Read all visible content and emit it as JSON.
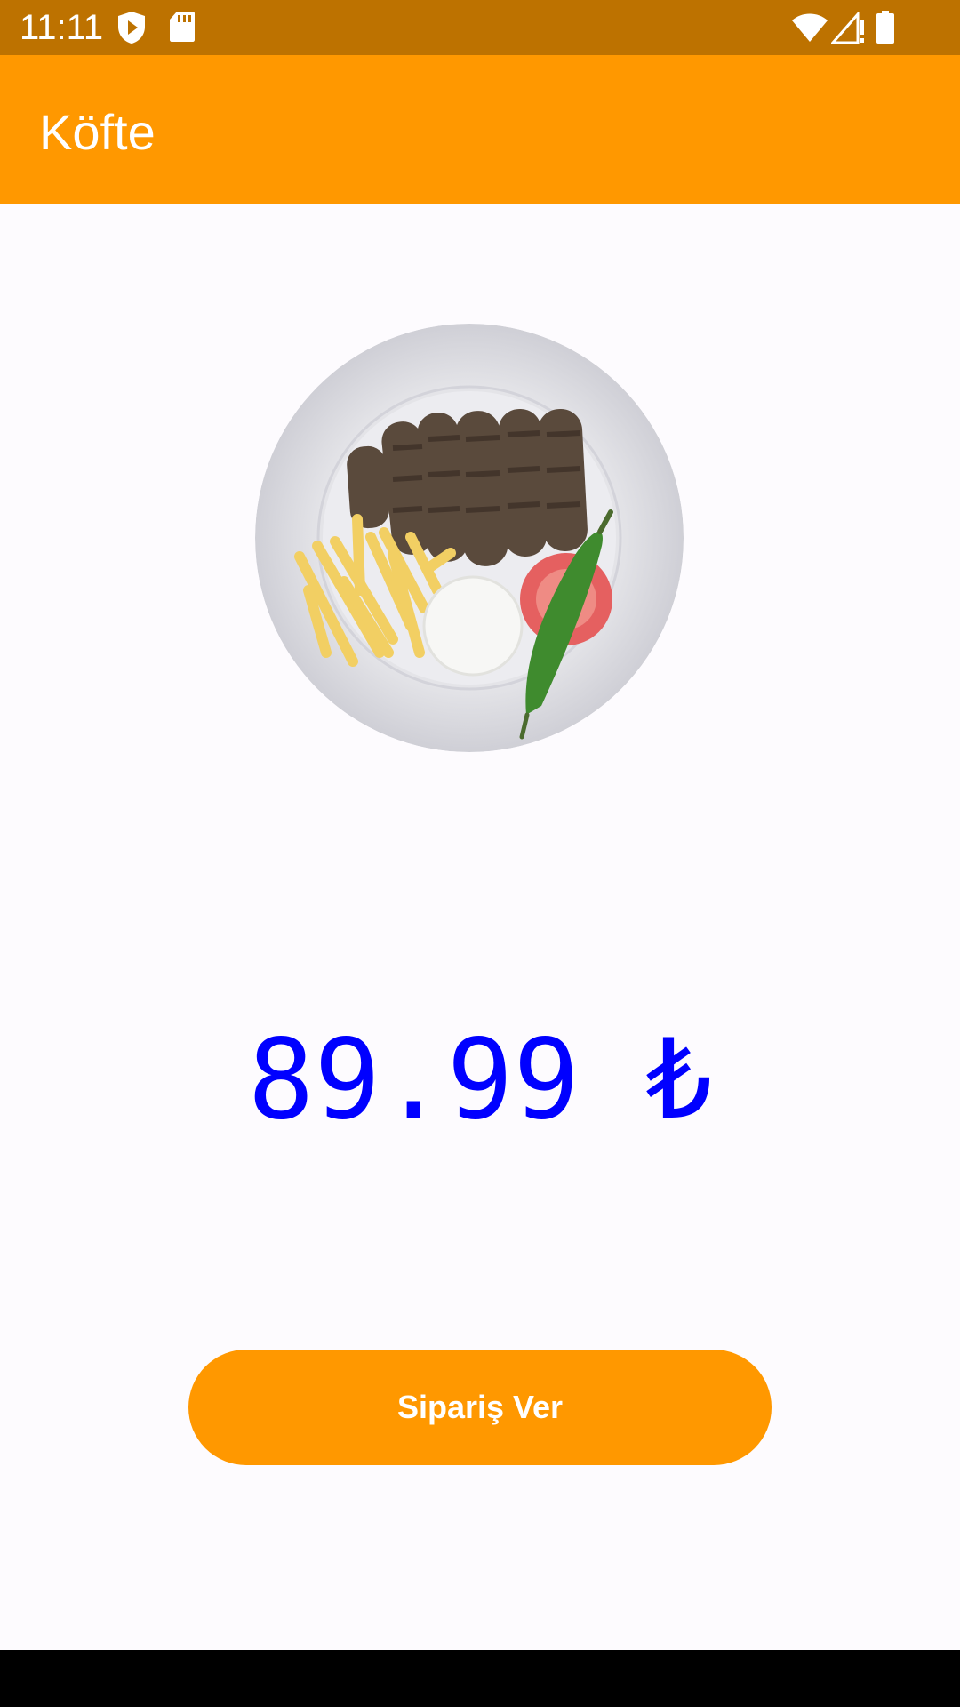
{
  "status_bar": {
    "time": "11:11",
    "icons": [
      "shield-play-icon",
      "sd-card-icon",
      "wifi-icon",
      "signal-alert-icon",
      "battery-icon"
    ]
  },
  "app_bar": {
    "title": "Köfte",
    "color": "#ff9800"
  },
  "product": {
    "image_icon": "kofte-plate-image",
    "price": "89.99 ₺",
    "price_color": "#0000ff"
  },
  "actions": {
    "order_label": "Sipariş Ver",
    "button_color": "#ff9800"
  }
}
